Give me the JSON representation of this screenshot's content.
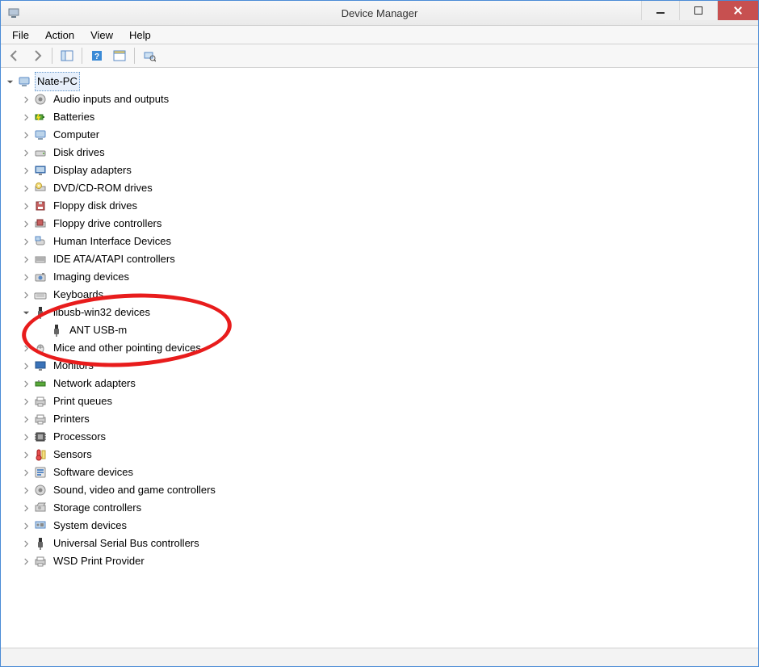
{
  "window": {
    "title": "Device Manager"
  },
  "menu": {
    "file": "File",
    "action": "Action",
    "view": "View",
    "help": "Help"
  },
  "tree": {
    "root": "Nate-PC",
    "items": [
      "Audio inputs and outputs",
      "Batteries",
      "Computer",
      "Disk drives",
      "Display adapters",
      "DVD/CD-ROM drives",
      "Floppy disk drives",
      "Floppy drive controllers",
      "Human Interface Devices",
      "IDE ATA/ATAPI controllers",
      "Imaging devices",
      "Keyboards",
      "libusb-win32 devices",
      "Mice and other pointing devices",
      "Monitors",
      "Network adapters",
      "Print queues",
      "Printers",
      "Processors",
      "Sensors",
      "Software devices",
      "Sound, video and game controllers",
      "Storage controllers",
      "System devices",
      "Universal Serial Bus controllers",
      "WSD Print Provider"
    ],
    "libusb_child": "ANT USB-m"
  },
  "icons": {
    "root": "computer-icon",
    "categories": [
      "speaker-icon",
      "battery-icon",
      "computer-icon",
      "disk-icon",
      "display-adapter-icon",
      "optical-drive-icon",
      "floppy-drive-icon",
      "floppy-controller-icon",
      "hid-icon",
      "ide-controller-icon",
      "camera-icon",
      "keyboard-icon",
      "usb-plug-icon",
      "mouse-icon",
      "monitor-icon",
      "network-adapter-icon",
      "printer-icon",
      "printer-icon",
      "cpu-icon",
      "sensor-icon",
      "software-device-icon",
      "speaker-icon",
      "storage-controller-icon",
      "system-device-icon",
      "usb-plug-icon",
      "printer-icon"
    ],
    "libusb_child": "usb-plug-icon"
  }
}
